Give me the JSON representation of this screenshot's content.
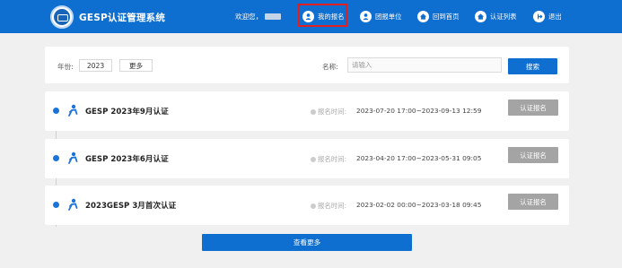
{
  "header": {
    "site_title": "GESP认证管理系统",
    "welcome": "欢迎您，",
    "nav": [
      {
        "label": "我的报名",
        "icon": "user-icon"
      },
      {
        "label": "团报单位",
        "icon": "user-icon"
      },
      {
        "label": "回到首页",
        "icon": "home-icon"
      },
      {
        "label": "认证列表",
        "icon": "home-icon"
      },
      {
        "label": "退出",
        "icon": "logout-icon"
      }
    ]
  },
  "search": {
    "year_label": "年份:",
    "year_value": "2023",
    "more_label": "更多",
    "name_label": "名称:",
    "name_placeholder": "请输入",
    "search_button": "搜索"
  },
  "certifications": [
    {
      "title": "GESP 2023年9月认证",
      "time_label": "报名时间:",
      "time_range": "2023-07-20 17:00~2023-09-13 12:59",
      "button": "认证报名"
    },
    {
      "title": "GESP 2023年6月认证",
      "time_label": "报名时间:",
      "time_range": "2023-04-20 17:00~2023-05-31 09:05",
      "button": "认证报名"
    },
    {
      "title": "2023GESP 3月首次认证",
      "time_label": "报名时间:",
      "time_range": "2023-02-02 00:00~2023-03-18 09:45",
      "button": "认证报名"
    }
  ],
  "load_more": "查看更多",
  "colors": {
    "primary": "#0f6fd0",
    "disabled_button": "#a4a4a4",
    "highlight": "#e02020"
  }
}
